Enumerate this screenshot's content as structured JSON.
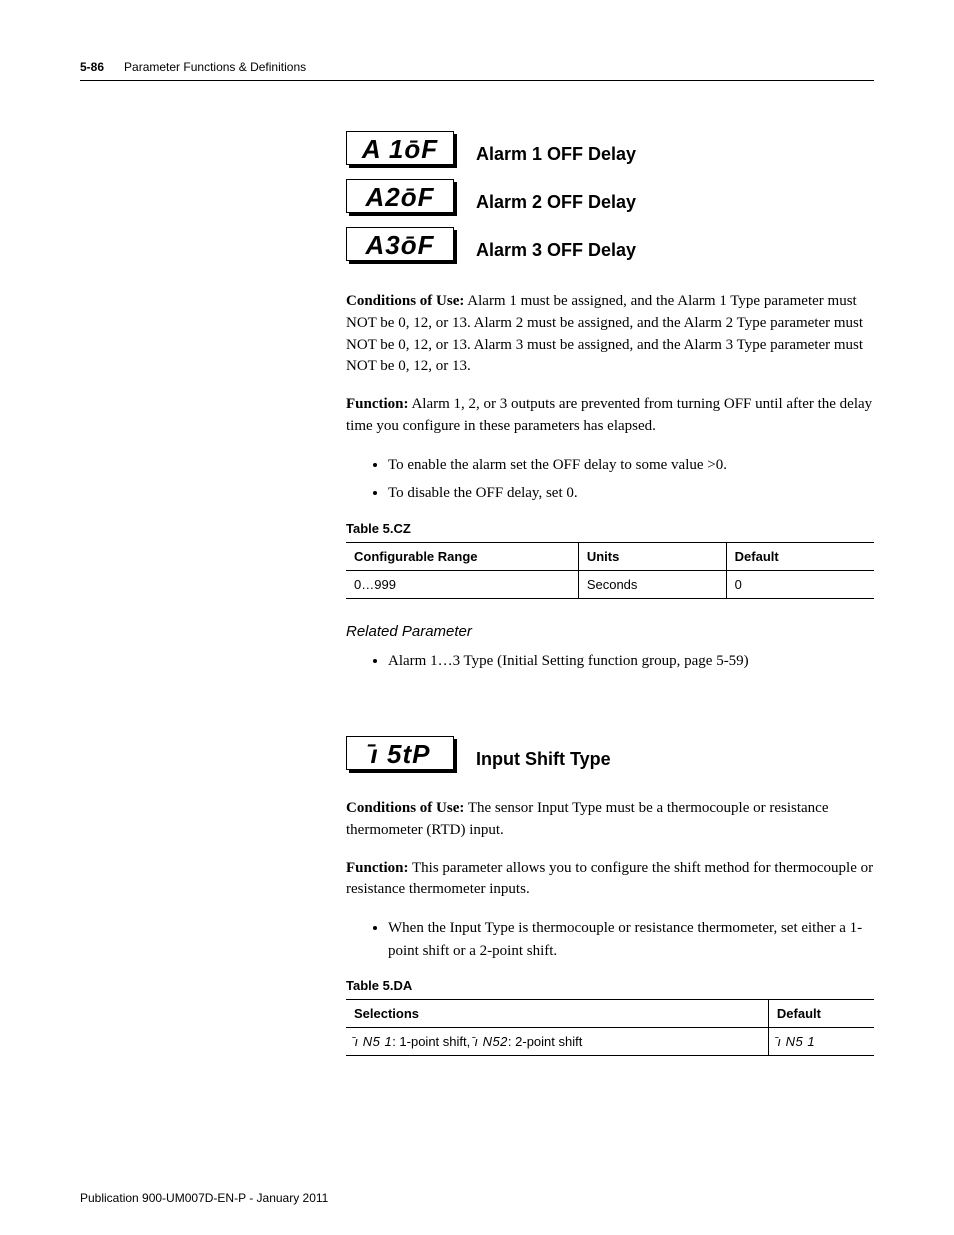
{
  "header": {
    "page_number": "5-86",
    "section": "Parameter Functions & Definitions"
  },
  "section1": {
    "lcd_rows": [
      {
        "code": "A 1ōF",
        "label": "Alarm 1 OFF Delay"
      },
      {
        "code": "A2ōF",
        "label": "Alarm 2 OFF Delay"
      },
      {
        "code": "A3ōF",
        "label": "Alarm 3 OFF Delay"
      }
    ],
    "conditions_label": "Conditions of Use:",
    "conditions_text": " Alarm 1 must be assigned, and the Alarm 1 Type parameter must NOT be 0, 12, or 13. Alarm 2 must be assigned, and the Alarm 2 Type parameter must NOT be 0, 12, or 13. Alarm 3 must be assigned, and the Alarm 3 Type parameter must NOT be 0, 12, or 13.",
    "function_label": "Function:",
    "function_text": " Alarm 1, 2, or 3 outputs are prevented from turning OFF until after the delay time you configure in these parameters has elapsed.",
    "bullets": [
      "To enable the alarm set the OFF delay to some value >0.",
      "To disable the OFF delay, set 0."
    ],
    "table_caption": "Table 5.CZ",
    "table_headers": [
      "Configurable Range",
      "Units",
      "Default"
    ],
    "table_row": [
      "0…999",
      "Seconds",
      "0"
    ],
    "related_label": "Related Parameter",
    "related_bullet": "Alarm 1…3 Type (Initial Setting function group, page 5-59)"
  },
  "section2": {
    "lcd_code": "̄ı 5tP",
    "lcd_label": "Input Shift Type",
    "conditions_label": "Conditions of Use:",
    "conditions_text": " The sensor Input Type must be a thermocouple or resistance thermometer (RTD) input.",
    "function_label": "Function:",
    "function_text": " This parameter allows you to configure the shift method for thermocouple or resistance thermometer inputs.",
    "bullets": [
      "When the Input Type is thermocouple or resistance thermometer, set either a 1-point shift or a 2-point shift."
    ],
    "table_caption": "Table 5.DA",
    "table_headers": [
      "Selections",
      "Default"
    ],
    "selections_code1": "̄ı N5 1",
    "selections_text1": ": 1-point shift, ",
    "selections_code2": "̄ı N52",
    "selections_text2": ": 2-point shift",
    "default_code": "̄ı N5 1"
  },
  "footer": "Publication 900-UM007D-EN-P - January 2011"
}
